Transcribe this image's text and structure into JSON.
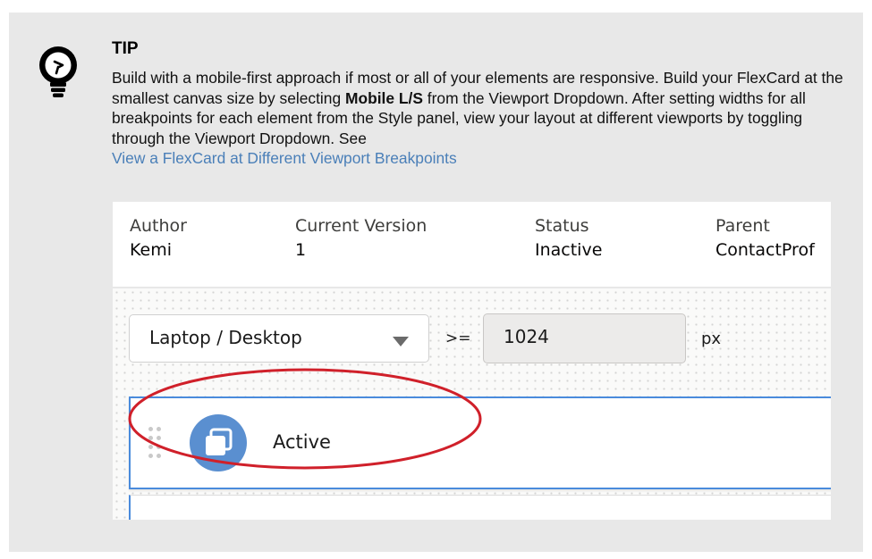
{
  "tip": {
    "title": "TIP",
    "body_part1": "Build with a mobile-first approach if most or all of your elements are responsive. Build your FlexCard at the smallest canvas size by selecting ",
    "body_bold": "Mobile L/S",
    "body_part2": " from the Viewport Dropdown. After setting widths for all breakpoints for each element from the Style panel, view your layout at different viewports by toggling through the Viewport Dropdown. See ",
    "link_text": "View a FlexCard at Different Viewport Breakpoints"
  },
  "header": {
    "author_label": "Author",
    "author_value": "Kemi",
    "version_label": "Current Version",
    "version_value": "1",
    "status_label": "Status",
    "status_value": "Inactive",
    "parent_label": "Parent",
    "parent_value": "ContactProf"
  },
  "viewport": {
    "selected": "Laptop / Desktop",
    "operator": ">=",
    "breakpoint_value": "1024",
    "unit": "px"
  },
  "state": {
    "label": "Active",
    "icon": "layers-icon"
  },
  "colors": {
    "highlight_ellipse": "#d0202a",
    "selection_border": "#4a8bdc",
    "link": "#4a7fb8",
    "icon_bg": "#5a8fd0"
  }
}
